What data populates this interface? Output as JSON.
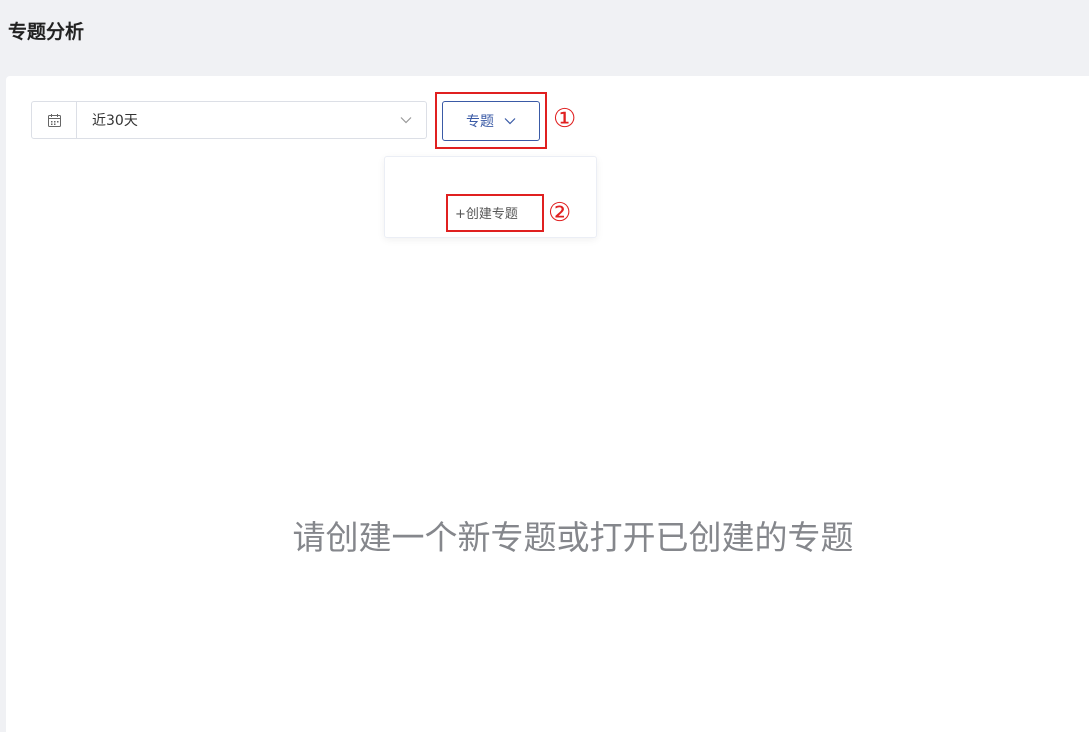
{
  "header": {
    "title": "专题分析"
  },
  "filters": {
    "date_range": {
      "value": "近30天",
      "icon": "calendar-icon"
    },
    "topic_select": {
      "label": "专题",
      "icon": "chevron-down-icon"
    }
  },
  "dropdown": {
    "create_label": "+创建专题"
  },
  "annotations": {
    "marker_1": "①",
    "marker_2": "②",
    "color": "#e02020"
  },
  "main": {
    "empty_message": "请创建一个新专题或打开已创建的专题"
  },
  "colors": {
    "accent": "#3a5aa6",
    "background": "#f0f1f4"
  }
}
